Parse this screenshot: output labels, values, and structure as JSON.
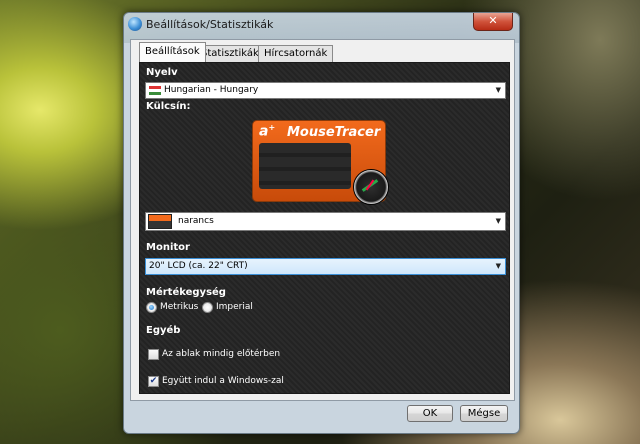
{
  "window": {
    "title": "Beállítások/Statisztikák",
    "close_glyph": "✕"
  },
  "tabs": [
    {
      "label": "Beállítások",
      "active": true
    },
    {
      "label": "Statisztikák",
      "active": false
    },
    {
      "label": "Hírcsatornák",
      "active": false
    }
  ],
  "language": {
    "label": "Nyelv",
    "value": "Hungarian - Hungary",
    "flag_icon": "hungary-flag-icon"
  },
  "skin": {
    "label": "Külcsín:",
    "logo_letter": "a",
    "logo_sup": "+",
    "logo_name": "MouseTracer",
    "value": "narancs"
  },
  "monitor": {
    "label": "Monitor",
    "value": "20\" LCD (ca. 22\" CRT)"
  },
  "units": {
    "label": "Mértékegység",
    "options": [
      {
        "label": "Metrikus",
        "checked": true
      },
      {
        "label": "Imperial",
        "checked": false
      }
    ]
  },
  "other": {
    "label": "Egyéb",
    "always_on_top": {
      "label": "Az ablak mindig előtérben",
      "checked": false
    },
    "start_with_windows": {
      "label": "Együtt indul a Windows-zal",
      "checked": true
    }
  },
  "buttons": {
    "ok": "OK",
    "cancel": "Mégse"
  },
  "check_glyph": "✔",
  "arrow_glyph": "▼"
}
